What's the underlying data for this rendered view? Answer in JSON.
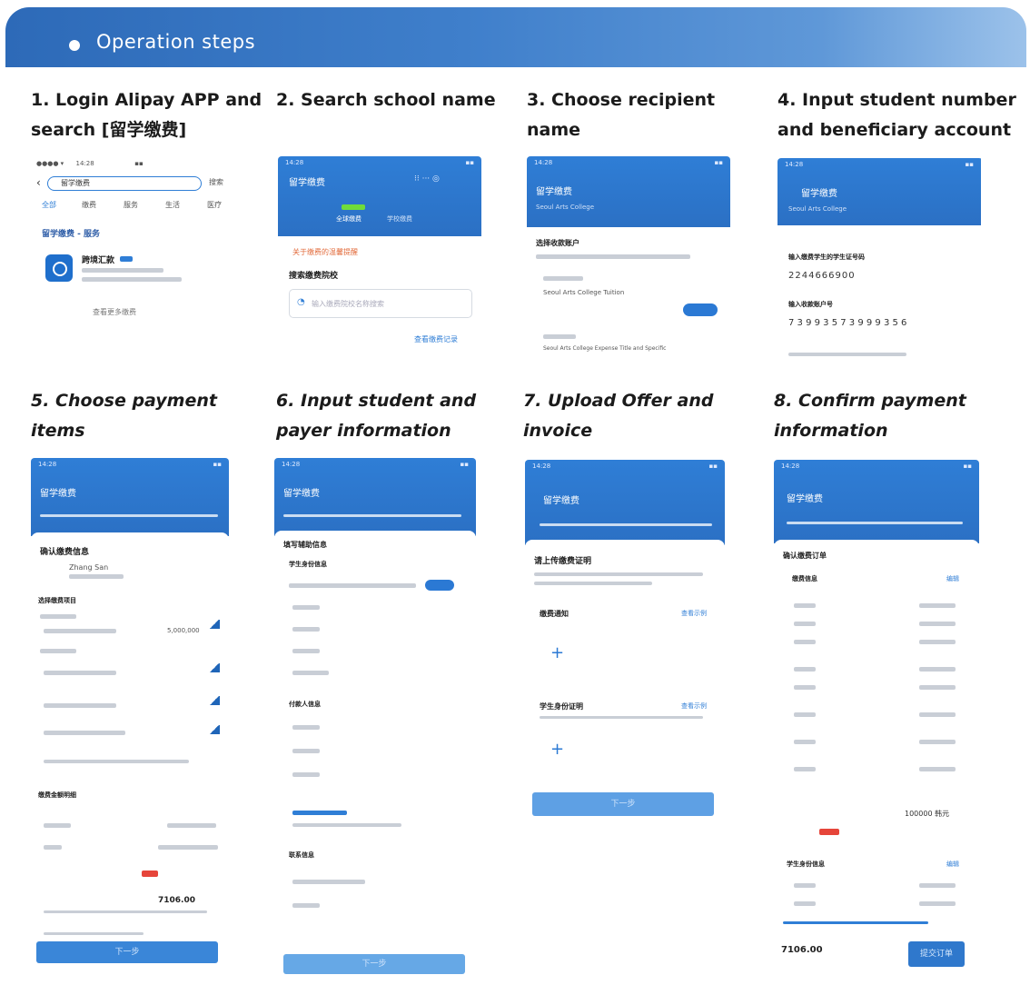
{
  "banner": {
    "title": "Operation steps"
  },
  "steps": [
    {
      "title": "1. Login Alipay APP and search [留学缴费]",
      "shot": {
        "search_value": "留学缴费",
        "search_button": "搜索",
        "tabs": [
          "全部",
          "缴费",
          "服务",
          "生活",
          "医疗"
        ],
        "section": "留学缴费 - 服务",
        "app_name": "跨境汇款",
        "link": "查看更多缴费"
      }
    },
    {
      "title": "2. Search school name",
      "shot": {
        "header": "留学缴费",
        "tab_a": "全球缴费",
        "tab_b": "学校缴费",
        "notice": "关于缴费的温馨提醒",
        "label": "搜索缴费院校",
        "placeholder": "输入缴费院校名称搜索",
        "link": "查看缴费记录"
      }
    },
    {
      "title": "3. Choose recipient name",
      "shot": {
        "header": "留学缴费",
        "school": "Seoul Arts College",
        "section": "选择收款账户",
        "item_a": "Seoul Arts College Tuition",
        "item_b": "Seoul Arts College Expense Title and Specific"
      }
    },
    {
      "title": "4. Input student number and beneficiary account",
      "shot": {
        "header": "留学缴费",
        "school": "Seoul Arts College",
        "label_a": "输入缴费学生的学生证号码",
        "student_number": "2244666900",
        "label_b": "输入收款账户号",
        "account": "7 3 9 9 3 5 7 3 9 9 9 3 5 6"
      }
    },
    {
      "title": "5. Choose payment items",
      "shot": {
        "header": "留学缴费",
        "section": "确认缴费信息",
        "name": "Zhang San",
        "group_a": "选择缴费项目",
        "group_b": "缴费金额明细",
        "amount_a": "5,000,000",
        "amount_b": "7106.00",
        "button": "下一步"
      }
    },
    {
      "title": "6. Input student and payer information",
      "shot": {
        "header": "留学缴费",
        "section": "填写辅助信息",
        "group_a": "学生身份信息",
        "group_b": "付款人信息",
        "group_c": "联系信息",
        "button": "下一步"
      }
    },
    {
      "title": "7. Upload Offer and invoice",
      "shot": {
        "header": "留学缴费",
        "section": "请上传缴费证明",
        "group_a": "缴费通知",
        "group_b": "学生身份证明",
        "link": "查看示例",
        "button": "下一步"
      }
    },
    {
      "title": "8. Confirm payment information",
      "shot": {
        "header": "留学缴费",
        "section": "确认缴费订单",
        "group_a": "缴费信息",
        "edit": "编辑",
        "total_cny": "100000 韩元",
        "group_b": "学生身份信息",
        "amount": "7106.00",
        "button": "提交订单"
      }
    }
  ]
}
